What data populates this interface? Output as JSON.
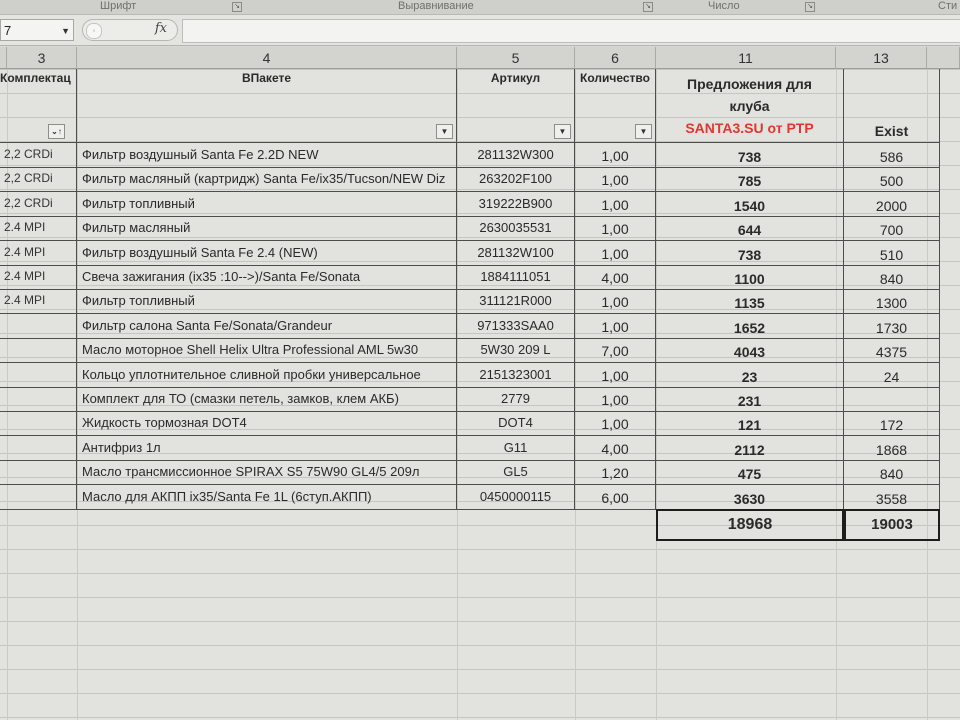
{
  "ribbon": {
    "group_font": "Шрифт",
    "group_align": "Выравнивание",
    "group_number": "Число",
    "group_styles": "Сти"
  },
  "formula_bar": {
    "name_box": "7",
    "fx": "fx",
    "value": ""
  },
  "columns": [
    {
      "id": "col3",
      "label": "3"
    },
    {
      "id": "col4",
      "label": "4"
    },
    {
      "id": "col5",
      "label": "5"
    },
    {
      "id": "col6",
      "label": "6"
    },
    {
      "id": "col11",
      "label": "11"
    },
    {
      "id": "col13",
      "label": "13"
    }
  ],
  "headers": {
    "komplekt": "Комплектац",
    "vpakete": "ВПакете",
    "artikul": "Артикул",
    "kolichestvo": "Количество",
    "offer_line1": "Предложения для",
    "offer_line2": "клуба",
    "offer_line3": "SANTA3.SU от PTP",
    "exist": "Exist"
  },
  "rows": [
    {
      "k": "2,2 CRDi",
      "name": "Фильтр воздушный Santa Fe 2.2D NEW",
      "art": "281132W300",
      "qty": "1,00",
      "offer": "738",
      "exist": "586"
    },
    {
      "k": "2,2 CRDi",
      "name": "Фильтр масляный (картридж) Santa Fe/ix35/Tucson/NEW Diz",
      "art": "263202F100",
      "qty": "1,00",
      "offer": "785",
      "exist": "500"
    },
    {
      "k": "2,2 CRDi",
      "name": "Фильтр топливный",
      "art": "319222B900",
      "qty": "1,00",
      "offer": "1540",
      "exist": "2000"
    },
    {
      "k": "2.4 MPI",
      "name": "Фильтр масляный",
      "art": "2630035531",
      "qty": "1,00",
      "offer": "644",
      "exist": "700"
    },
    {
      "k": "2.4 MPI",
      "name": "Фильтр воздушный Santa Fe 2.4 (NEW)",
      "art": "281132W100",
      "qty": "1,00",
      "offer": "738",
      "exist": "510"
    },
    {
      "k": "2.4 MPI",
      "name": "Свеча зажигания (ix35 :10-->)/Santa Fe/Sonata",
      "art": "1884111051",
      "qty": "4,00",
      "offer": "1100",
      "exist": "840"
    },
    {
      "k": "2.4 MPI",
      "name": "Фильтр топливный",
      "art": "311121R000",
      "qty": "1,00",
      "offer": "1135",
      "exist": "1300"
    },
    {
      "k": "",
      "name": "Фильтр салона Santa Fe/Sonata/Grandeur",
      "art": "971333SAA0",
      "qty": "1,00",
      "offer": "1652",
      "exist": "1730"
    },
    {
      "k": "",
      "name": "Масло моторное Shell Helix Ultra Professional AML 5w30",
      "art": "5W30 209 L",
      "qty": "7,00",
      "offer": "4043",
      "exist": "4375"
    },
    {
      "k": "",
      "name": "Кольцо уплотнительное сливной пробки универсальное",
      "art": "2151323001",
      "qty": "1,00",
      "offer": "23",
      "exist": "24"
    },
    {
      "k": "",
      "name": "Комплект для ТО (смазки петель, замков, клем АКБ)",
      "art": "2779",
      "qty": "1,00",
      "offer": "231",
      "exist": ""
    },
    {
      "k": "",
      "name": "Жидкость тормозная DOT4",
      "art": "DOT4",
      "qty": "1,00",
      "offer": "121",
      "exist": "172"
    },
    {
      "k": "",
      "name": "Антифриз 1л",
      "art": "G11",
      "qty": "4,00",
      "offer": "2112",
      "exist": "1868"
    },
    {
      "k": "",
      "name": "Масло трансмиссионное SPIRAX S5 75W90 GL4/5 209л",
      "art": "GL5",
      "qty": "1,20",
      "offer": "475",
      "exist": "840"
    },
    {
      "k": "",
      "name": "Масло для АКПП ix35/Santa Fe 1L (6ступ.АКПП)",
      "art": "0450000115",
      "qty": "6,00",
      "offer": "3630",
      "exist": "3558"
    }
  ],
  "totals": {
    "offer": "18968",
    "exist": "19003"
  },
  "colors": {
    "accent_red": "#e2362e"
  }
}
